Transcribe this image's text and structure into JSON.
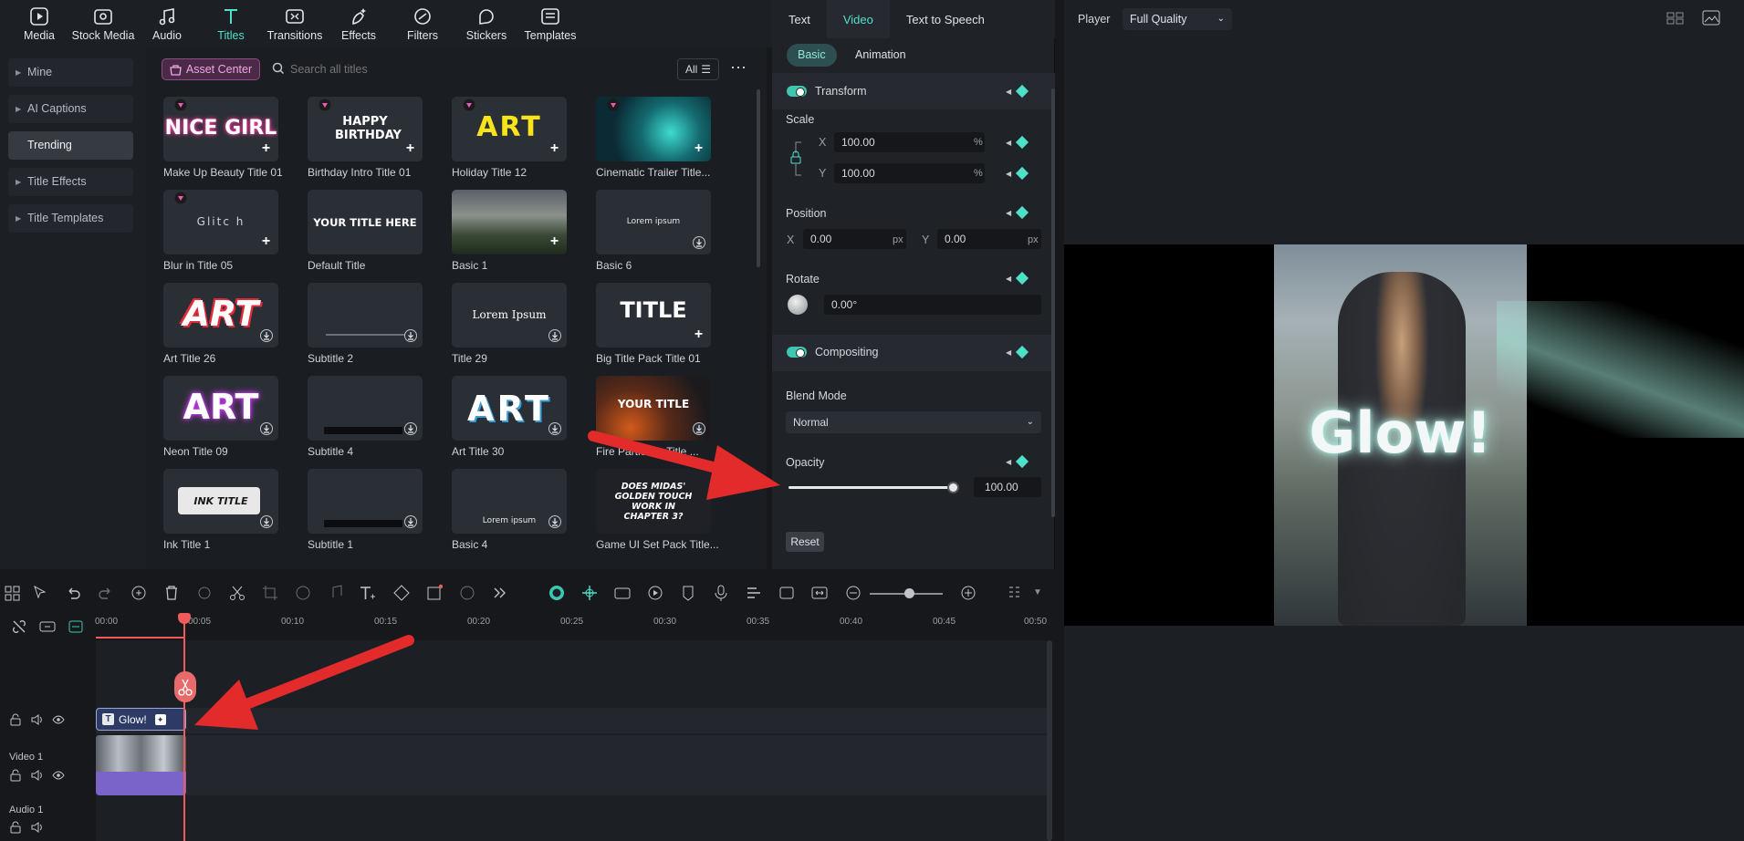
{
  "nav": {
    "items": [
      {
        "label": "Media",
        "icon": "media-icon"
      },
      {
        "label": "Stock Media",
        "icon": "stock-media-icon"
      },
      {
        "label": "Audio",
        "icon": "audio-icon"
      },
      {
        "label": "Titles",
        "icon": "titles-icon"
      },
      {
        "label": "Transitions",
        "icon": "transitions-icon"
      },
      {
        "label": "Effects",
        "icon": "effects-icon"
      },
      {
        "label": "Filters",
        "icon": "filters-icon"
      },
      {
        "label": "Stickers",
        "icon": "stickers-icon"
      },
      {
        "label": "Templates",
        "icon": "templates-icon"
      }
    ],
    "active": "Titles"
  },
  "sidebar": {
    "items": [
      {
        "label": "Mine",
        "expandable": true
      },
      {
        "label": "AI Captions",
        "expandable": true
      },
      {
        "label": "Trending",
        "expandable": false
      },
      {
        "label": "Title Effects",
        "expandable": true
      },
      {
        "label": "Title Templates",
        "expandable": true
      }
    ],
    "active": "Trending"
  },
  "library": {
    "asset_center": "Asset Center",
    "search_placeholder": "Search all titles",
    "filter_label": "All",
    "tiles": [
      {
        "label": "Make Up Beauty Title 01",
        "text": "NICE GIRL"
      },
      {
        "label": "Birthday Intro Title 01",
        "text": "HAPPY BIRTHDAY"
      },
      {
        "label": "Holiday Title 12",
        "text": "ART"
      },
      {
        "label": "Cinematic Trailer Title...",
        "text": ""
      },
      {
        "label": "Blur in Title 05",
        "text": "Glitc h"
      },
      {
        "label": "Default Title",
        "text": "YOUR TITLE HERE"
      },
      {
        "label": "Basic 1",
        "text": ""
      },
      {
        "label": "Basic 6",
        "text": "Lorem ipsum"
      },
      {
        "label": "Art Title 26",
        "text": "ART"
      },
      {
        "label": "Subtitle 2",
        "text": ""
      },
      {
        "label": "Title 29",
        "text": "Lorem Ipsum"
      },
      {
        "label": "Big Title Pack Title 01",
        "text": "TITLE"
      },
      {
        "label": "Neon Title 09",
        "text": "ART"
      },
      {
        "label": "Subtitle 4",
        "text": ""
      },
      {
        "label": "Art Title 30",
        "text": "ART"
      },
      {
        "label": "Fire Particle... Title ...",
        "text": "YOUR TITLE"
      },
      {
        "label": "Ink Title 1",
        "text": "INK TITLE"
      },
      {
        "label": "Subtitle 1",
        "text": ""
      },
      {
        "label": "Basic 4",
        "text": "Lorem ipsum"
      },
      {
        "label": "Game UI Set Pack Title...",
        "text": "DOES MIDAS' GOLDEN TOUCH WORK IN CHAPTER 3?"
      }
    ]
  },
  "props": {
    "tabs": [
      "Text",
      "Video",
      "Text to Speech"
    ],
    "active_tab": "Video",
    "subtabs": [
      "Basic",
      "Animation"
    ],
    "active_subtab": "Basic",
    "transform": "Transform",
    "scale": "Scale",
    "scale_x": "100.00",
    "scale_y": "100.00",
    "x_label": "X",
    "y_label": "Y",
    "pct": "%",
    "position": "Position",
    "pos_x": "0.00",
    "pos_y": "0.00",
    "px": "px",
    "rotate": "Rotate",
    "rotate_value": "0.00°",
    "compositing": "Compositing",
    "blend_mode": "Blend Mode",
    "blend_value": "Normal",
    "opacity": "Opacity",
    "opacity_value": "100.00",
    "opacity_level": 1.0,
    "reset": "Reset"
  },
  "player": {
    "label": "Player",
    "quality": "Full Quality",
    "overlay_text": "Glow!"
  },
  "timeline": {
    "ticks": [
      "00:00",
      "00:05",
      "00:10",
      "00:15",
      "00:20",
      "00:25",
      "00:30",
      "00:35",
      "00:40",
      "00:45",
      "00:50"
    ],
    "title_clip": "Glow!",
    "video_track": "Video 1",
    "audio_track": "Audio 1"
  },
  "colors": {
    "accent": "#4fe0c9",
    "playhead": "#ef5b5b",
    "annotation": "#e32b2b"
  }
}
